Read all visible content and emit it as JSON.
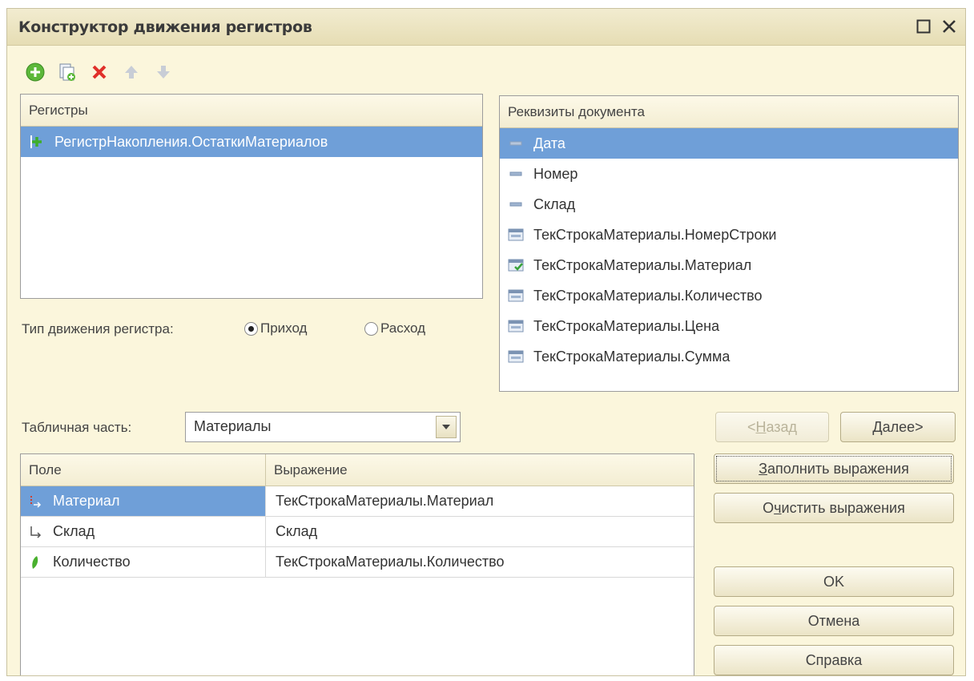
{
  "window": {
    "title": "Конструктор движения регистров",
    "maximize_icon": "maximize-icon",
    "close_icon": "close-icon"
  },
  "toolbar": {
    "icons": [
      "add-icon",
      "copy-icon",
      "delete-icon",
      "move-up-icon",
      "move-down-icon"
    ]
  },
  "registers": {
    "header": "Регистры",
    "items": [
      {
        "label": "РегистрНакопления.ОстаткиМатериалов",
        "icon": "accumulation-register-icon",
        "selected": true
      }
    ]
  },
  "movement_type": {
    "label": "Тип движения регистра:",
    "options": [
      {
        "label": "Приход",
        "selected": true
      },
      {
        "label": "Расход",
        "selected": false
      }
    ]
  },
  "doc_attributes": {
    "header": "Реквизиты документа",
    "items": [
      {
        "label": "Дата",
        "icon": "attribute-icon",
        "selected": true
      },
      {
        "label": "Номер",
        "icon": "attribute-icon"
      },
      {
        "label": "Склад",
        "icon": "attribute-icon"
      },
      {
        "label": "ТекСтрокаМатериалы.НомерСтроки",
        "icon": "table-attribute-icon"
      },
      {
        "label": "ТекСтрокаМатериалы.Материал",
        "icon": "table-attribute-check-icon"
      },
      {
        "label": "ТекСтрокаМатериалы.Количество",
        "icon": "table-attribute-icon"
      },
      {
        "label": "ТекСтрокаМатериалы.Цена",
        "icon": "table-attribute-icon"
      },
      {
        "label": "ТекСтрокаМатериалы.Сумма",
        "icon": "table-attribute-icon"
      }
    ]
  },
  "tabular": {
    "label": "Табличная часть:",
    "value": "Материалы"
  },
  "grid": {
    "columns": [
      "Поле",
      "Выражение"
    ],
    "rows": [
      {
        "field": "Материал",
        "expression": "ТекСтрокаМатериалы.Материал",
        "icon": "dimension-icon",
        "selected": true
      },
      {
        "field": "Склад",
        "expression": "Склад",
        "icon": "dimension-icon"
      },
      {
        "field": "Количество",
        "expression": "ТекСтрокаМатериалы.Количество",
        "icon": "resource-icon"
      }
    ]
  },
  "buttons": {
    "back": {
      "prefix": "<",
      "accel": "Н",
      "rest": "азад"
    },
    "next": {
      "accel": "Д",
      "rest": "алее>"
    },
    "fill": {
      "accel": "З",
      "rest": "аполнить выражения"
    },
    "clear": {
      "prefix": "О",
      "accel": "ч",
      "rest": "истить выражения"
    },
    "ok": "OK",
    "cancel": "Отмена",
    "help": "Справка"
  }
}
